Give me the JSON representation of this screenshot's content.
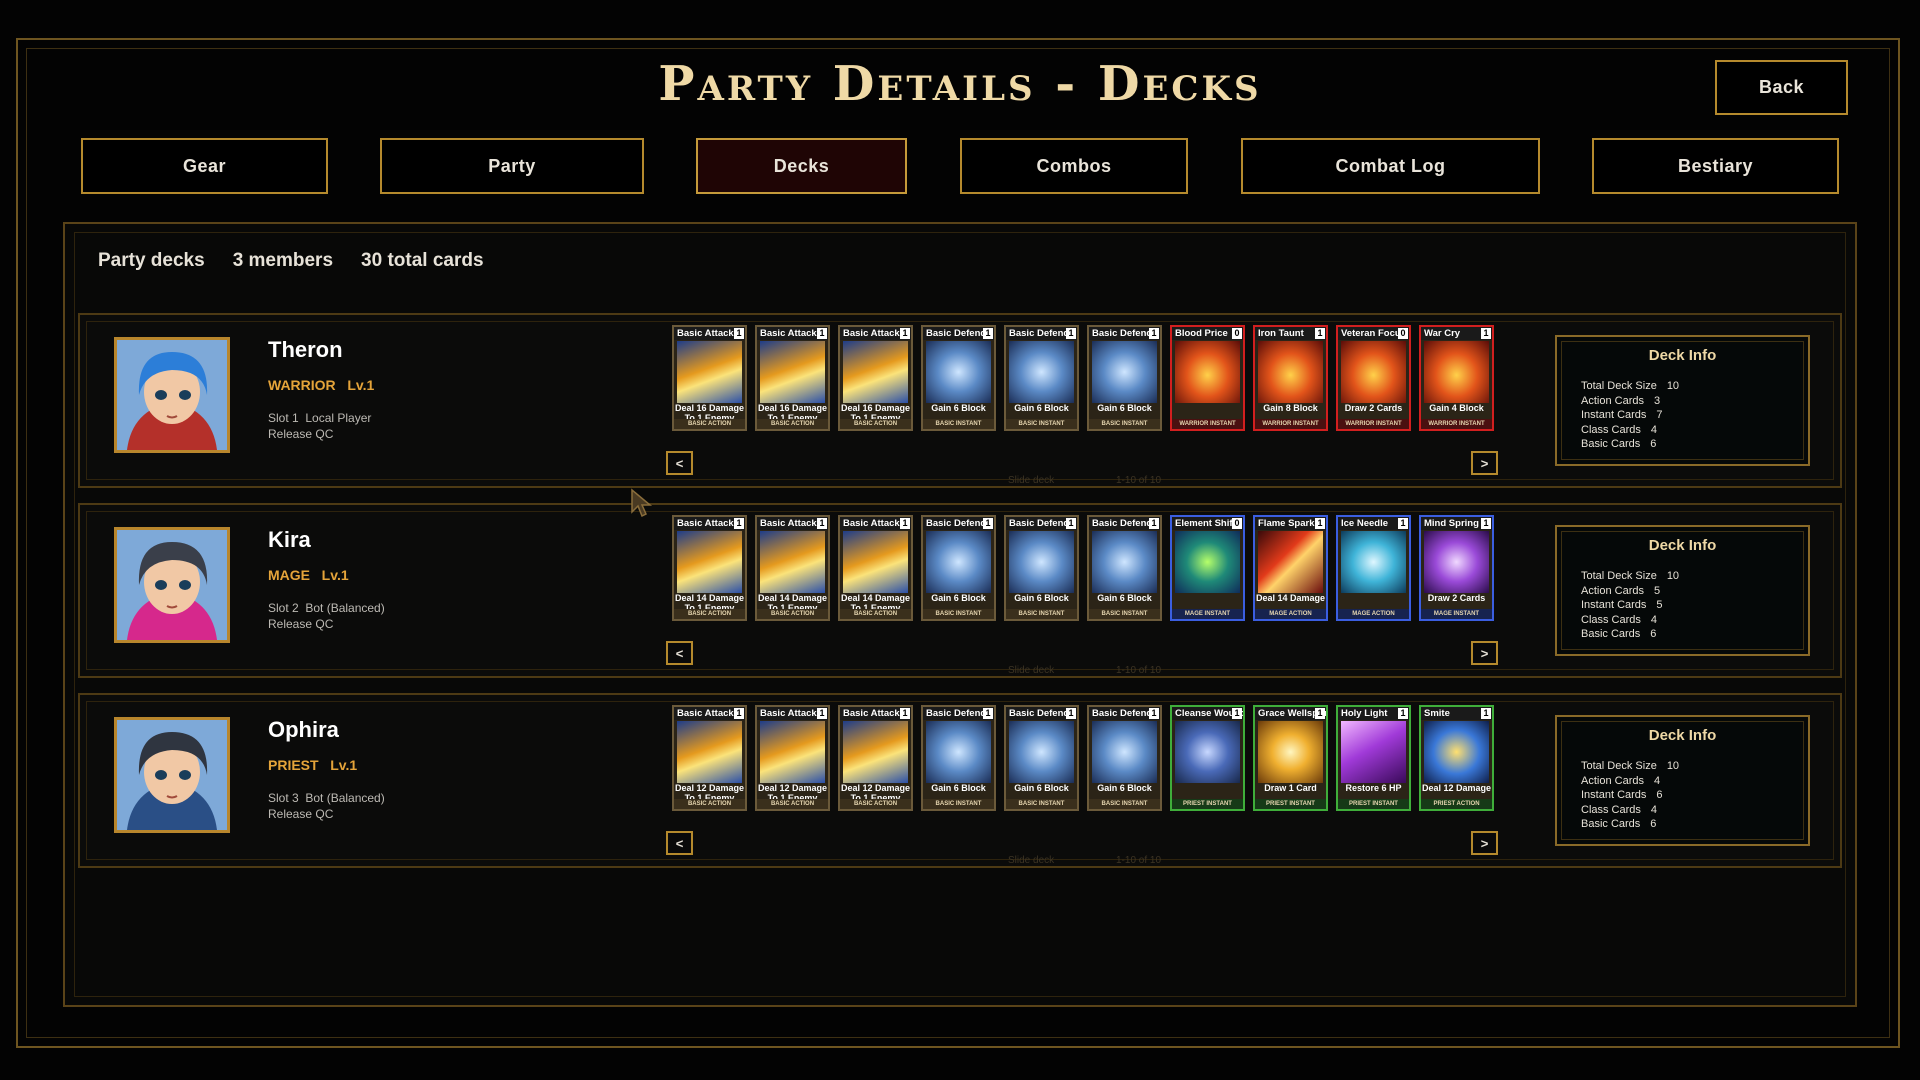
{
  "title": "Party Details - Decks",
  "back_label": "Back",
  "tabs": [
    {
      "label": "Gear",
      "active": false
    },
    {
      "label": "Party",
      "active": false
    },
    {
      "label": "Decks",
      "active": true
    },
    {
      "label": "Combos",
      "active": false
    },
    {
      "label": "Combat Log",
      "active": false
    },
    {
      "label": "Bestiary",
      "active": false
    }
  ],
  "summary": {
    "label": "Party decks",
    "members": "3 members",
    "total": "30 total cards"
  },
  "members": [
    {
      "name": "Theron",
      "class_level": "WARRIOR   Lv.1",
      "slot": "Slot 1  Local Player",
      "release": "Release QC",
      "portrait": {
        "hair": "#2c7ed8",
        "skin": "#f1c8a5",
        "accent": "#b4302a"
      },
      "prev_label": "<",
      "next_label": ">",
      "slide_label": "Slide deck",
      "page_label": "1-10 of 10",
      "cards": [
        {
          "name": "Basic Attack",
          "cost": "1",
          "text": "Deal 16 Damage To 1 Enemy",
          "foot": "BASIC ACTION",
          "kind": "attack"
        },
        {
          "name": "Basic Attack",
          "cost": "1",
          "text": "Deal 16 Damage To 1 Enemy",
          "foot": "BASIC ACTION",
          "kind": "attack"
        },
        {
          "name": "Basic Attack",
          "cost": "1",
          "text": "Deal 16 Damage To 1 Enemy",
          "foot": "BASIC ACTION",
          "kind": "attack"
        },
        {
          "name": "Basic Defend",
          "cost": "1",
          "text": "Gain 6 Block",
          "foot": "BASIC INSTANT",
          "kind": "defend"
        },
        {
          "name": "Basic Defend",
          "cost": "1",
          "text": "Gain 6 Block",
          "foot": "BASIC INSTANT",
          "kind": "defend"
        },
        {
          "name": "Basic Defend",
          "cost": "1",
          "text": "Gain 6 Block",
          "foot": "BASIC INSTANT",
          "kind": "defend"
        },
        {
          "name": "Blood Price",
          "cost": "0",
          "text": "",
          "foot": "WARRIOR INSTANT",
          "kind": "warrior"
        },
        {
          "name": "Iron Taunt",
          "cost": "1",
          "text": "Gain 8 Block",
          "foot": "WARRIOR INSTANT",
          "kind": "warrior"
        },
        {
          "name": "Veteran Focus",
          "cost": "0",
          "text": "Draw 2 Cards",
          "foot": "WARRIOR INSTANT",
          "kind": "warrior"
        },
        {
          "name": "War Cry",
          "cost": "1",
          "text": "Gain 4 Block",
          "foot": "WARRIOR INSTANT",
          "kind": "warrior"
        }
      ],
      "deck_info": {
        "title": "Deck Info",
        "rows": [
          {
            "label": "Total Deck Size",
            "value": "10"
          },
          {
            "label": "Action Cards",
            "value": "3"
          },
          {
            "label": "Instant Cards",
            "value": "7"
          },
          {
            "label": "Class Cards",
            "value": "4"
          },
          {
            "label": "Basic Cards",
            "value": "6"
          }
        ]
      }
    },
    {
      "name": "Kira",
      "class_level": "MAGE   Lv.1",
      "slot": "Slot 2  Bot (Balanced)",
      "release": "Release QC",
      "portrait": {
        "hair": "#3a3f4a",
        "skin": "#f1c8a5",
        "accent": "#d6288c"
      },
      "prev_label": "<",
      "next_label": ">",
      "slide_label": "Slide deck",
      "page_label": "1-10 of 10",
      "cards": [
        {
          "name": "Basic Attack",
          "cost": "1",
          "text": "Deal 14 Damage To 1 Enemy",
          "foot": "BASIC ACTION",
          "kind": "attack"
        },
        {
          "name": "Basic Attack",
          "cost": "1",
          "text": "Deal 14 Damage To 1 Enemy",
          "foot": "BASIC ACTION",
          "kind": "attack"
        },
        {
          "name": "Basic Attack",
          "cost": "1",
          "text": "Deal 14 Damage To 1 Enemy",
          "foot": "BASIC ACTION",
          "kind": "attack"
        },
        {
          "name": "Basic Defend",
          "cost": "1",
          "text": "Gain 6 Block",
          "foot": "BASIC INSTANT",
          "kind": "defend"
        },
        {
          "name": "Basic Defend",
          "cost": "1",
          "text": "Gain 6 Block",
          "foot": "BASIC INSTANT",
          "kind": "defend"
        },
        {
          "name": "Basic Defend",
          "cost": "1",
          "text": "Gain 6 Block",
          "foot": "BASIC INSTANT",
          "kind": "defend"
        },
        {
          "name": "Element Shift",
          "cost": "0",
          "text": "",
          "foot": "MAGE INSTANT",
          "kind": "mage-green"
        },
        {
          "name": "Flame Spark",
          "cost": "1",
          "text": "Deal 14 Damage",
          "foot": "MAGE ACTION",
          "kind": "mage-red"
        },
        {
          "name": "Ice Needle",
          "cost": "1",
          "text": "",
          "foot": "MAGE ACTION",
          "kind": "mage-ice"
        },
        {
          "name": "Mind Spring",
          "cost": "1",
          "text": "Draw 2 Cards",
          "foot": "MAGE INSTANT",
          "kind": "mage-purple"
        }
      ],
      "deck_info": {
        "title": "Deck Info",
        "rows": [
          {
            "label": "Total Deck Size",
            "value": "10"
          },
          {
            "label": "Action Cards",
            "value": "5"
          },
          {
            "label": "Instant Cards",
            "value": "5"
          },
          {
            "label": "Class Cards",
            "value": "4"
          },
          {
            "label": "Basic Cards",
            "value": "6"
          }
        ]
      }
    },
    {
      "name": "Ophira",
      "class_level": "PRIEST   Lv.1",
      "slot": "Slot 3  Bot (Balanced)",
      "release": "Release QC",
      "portrait": {
        "hair": "#2f3540",
        "skin": "#f1c8a5",
        "accent": "#2a4f86"
      },
      "prev_label": "<",
      "next_label": ">",
      "slide_label": "Slide deck",
      "page_label": "1-10 of 10",
      "cards": [
        {
          "name": "Basic Attack",
          "cost": "1",
          "text": "Deal 12 Damage To 1 Enemy",
          "foot": "BASIC ACTION",
          "kind": "attack"
        },
        {
          "name": "Basic Attack",
          "cost": "1",
          "text": "Deal 12 Damage To 1 Enemy",
          "foot": "BASIC ACTION",
          "kind": "attack"
        },
        {
          "name": "Basic Attack",
          "cost": "1",
          "text": "Deal 12 Damage To 1 Enemy",
          "foot": "BASIC ACTION",
          "kind": "attack"
        },
        {
          "name": "Basic Defend",
          "cost": "1",
          "text": "Gain 6 Block",
          "foot": "BASIC INSTANT",
          "kind": "defend"
        },
        {
          "name": "Basic Defend",
          "cost": "1",
          "text": "Gain 6 Block",
          "foot": "BASIC INSTANT",
          "kind": "defend"
        },
        {
          "name": "Basic Defend",
          "cost": "1",
          "text": "Gain 6 Block",
          "foot": "BASIC INSTANT",
          "kind": "defend"
        },
        {
          "name": "Cleanse Wound",
          "cost": "1",
          "text": "",
          "foot": "PRIEST INSTANT",
          "kind": "priest-ice"
        },
        {
          "name": "Grace Wellspring",
          "cost": "1",
          "text": "Draw 1 Card",
          "foot": "PRIEST INSTANT",
          "kind": "priest-gold"
        },
        {
          "name": "Holy Light",
          "cost": "1",
          "text": "Restore 6 HP",
          "foot": "PRIEST INSTANT",
          "kind": "priest-purple"
        },
        {
          "name": "Smite",
          "cost": "1",
          "text": "Deal 12 Damage",
          "foot": "PRIEST ACTION",
          "kind": "priest-smite"
        }
      ],
      "deck_info": {
        "title": "Deck Info",
        "rows": [
          {
            "label": "Total Deck Size",
            "value": "10"
          },
          {
            "label": "Action Cards",
            "value": "4"
          },
          {
            "label": "Instant Cards",
            "value": "6"
          },
          {
            "label": "Class Cards",
            "value": "4"
          },
          {
            "label": "Basic Cards",
            "value": "6"
          }
        ]
      }
    }
  ]
}
